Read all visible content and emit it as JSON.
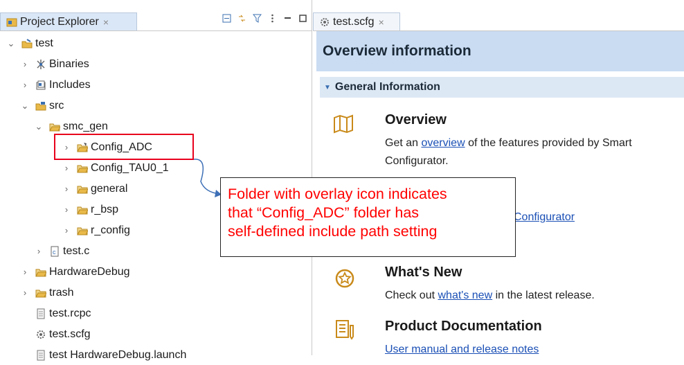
{
  "left_tab": {
    "label": "Project Explorer",
    "close": "×"
  },
  "right_tab": {
    "label": "test.scfg",
    "close": "×"
  },
  "tree": {
    "test": "test",
    "binaries": "Binaries",
    "includes": "Includes",
    "src": "src",
    "smc_gen": "smc_gen",
    "config_adc": "Config_ADC",
    "config_tau": "Config_TAU0_1",
    "general": "general",
    "r_bsp": "r_bsp",
    "r_config": "r_config",
    "test_c": "test.c",
    "hardware_debug": "HardwareDebug",
    "trash": "trash",
    "test_rcpc": "test.rcpc",
    "test_scfg": "test.scfg",
    "test_launch": "test HardwareDebug.launch"
  },
  "callout": {
    "line1": "Folder with overlay icon indicates",
    "line2": "that “Config_ADC” folder has",
    "line3": "self-defined include path setting"
  },
  "overview": {
    "header": "Overview information",
    "section": "General Information",
    "item1_title": "Overview",
    "item1_pre": "Get an ",
    "item1_link": "overview",
    "item1_post": " of the features provided by Smart",
    "item1_line2": "Configurator.",
    "item2_link": "Configurator",
    "item3_title": "What's New",
    "item3_pre": "Check out ",
    "item3_link": "what's new",
    "item3_post": " in the latest release.",
    "item4_title": "Product Documentation",
    "item4_link": "User manual and release notes"
  },
  "colors": {
    "accent_red": "#e8001c",
    "link_blue": "#1a4fb5",
    "header_bg": "#c9dcf2"
  }
}
